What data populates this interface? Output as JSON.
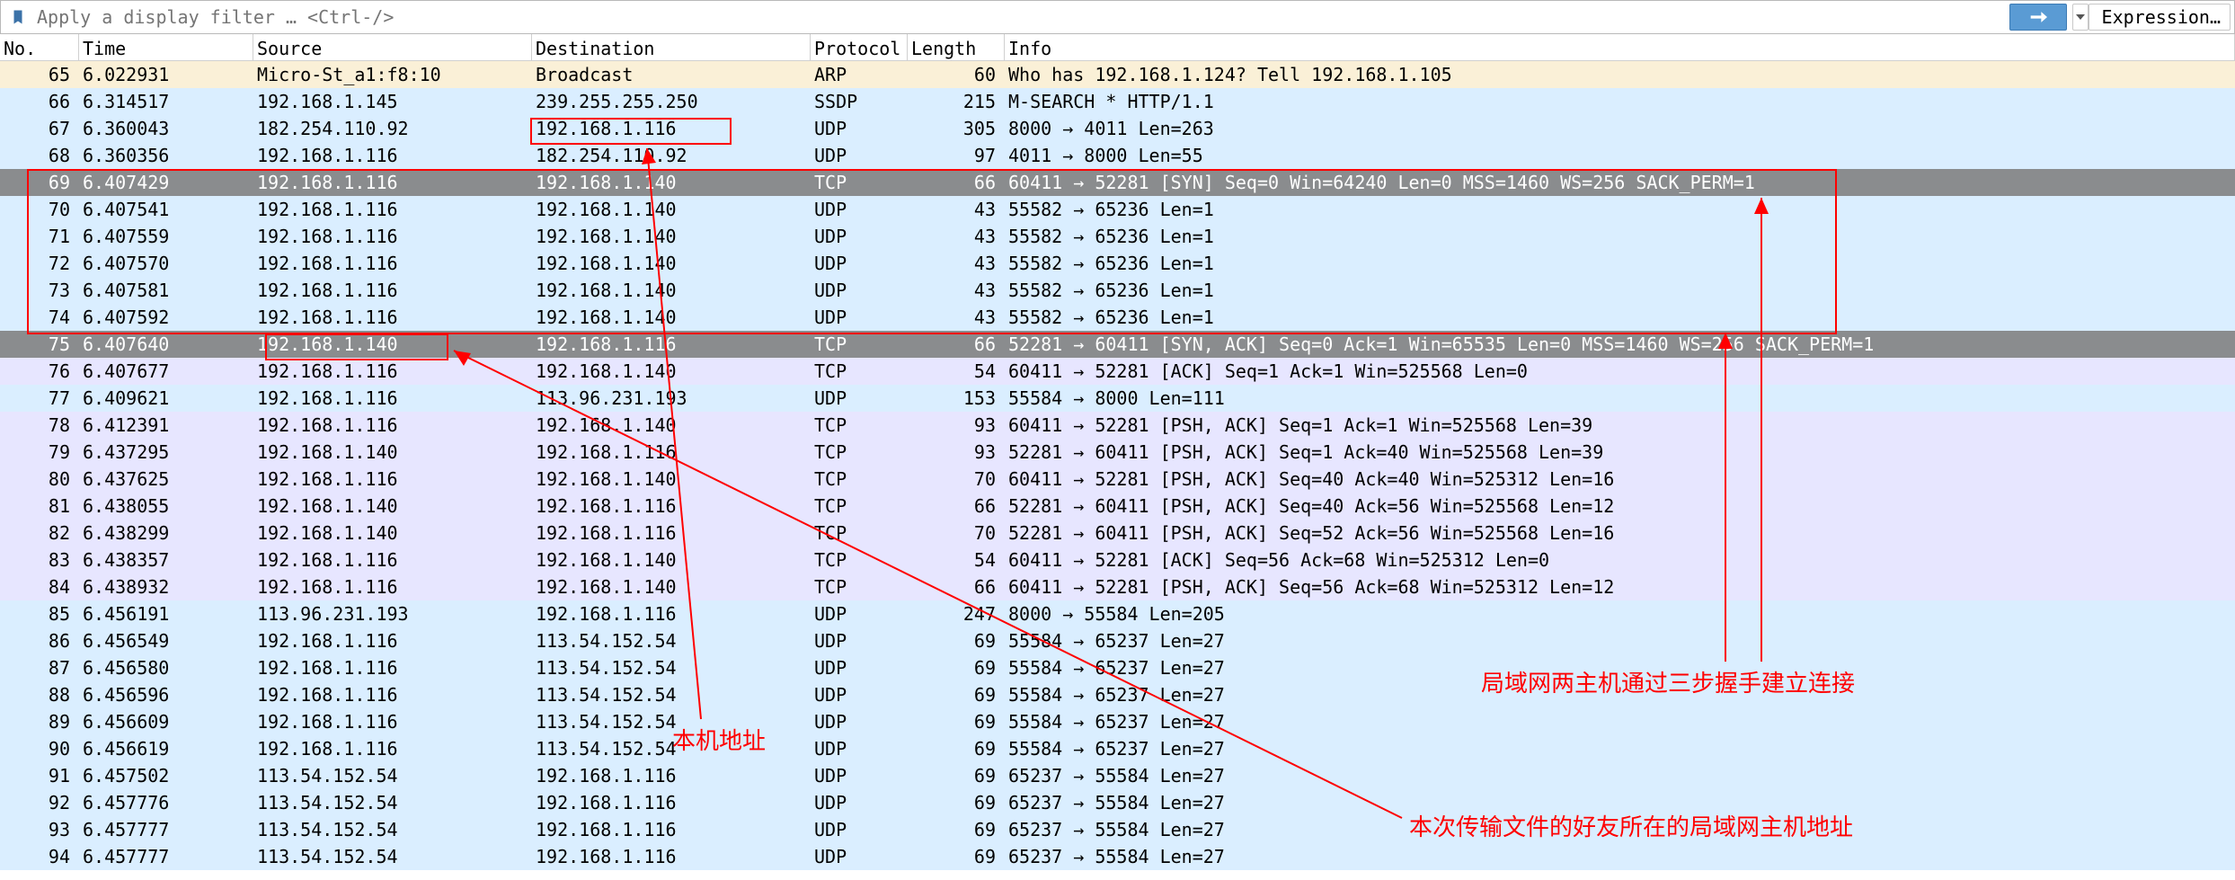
{
  "filter": {
    "placeholder": "Apply a display filter … <Ctrl-/>",
    "expression_label": "Expression…"
  },
  "columns": {
    "no": "No.",
    "time": "Time",
    "src": "Source",
    "dst": "Destination",
    "proto": "Protocol",
    "len": "Length",
    "info": "Info"
  },
  "packets": [
    {
      "no": 65,
      "time": "6.022931",
      "src": "Micro-St_a1:f8:10",
      "dst": "Broadcast",
      "proto": "ARP",
      "len": 60,
      "info": "Who has 192.168.1.124? Tell 192.168.1.105",
      "cls": "arp"
    },
    {
      "no": 66,
      "time": "6.314517",
      "src": "192.168.1.145",
      "dst": "239.255.255.250",
      "proto": "SSDP",
      "len": 215,
      "info": "M-SEARCH * HTTP/1.1",
      "cls": "udp"
    },
    {
      "no": 67,
      "time": "6.360043",
      "src": "182.254.110.92",
      "dst": "192.168.1.116",
      "proto": "UDP",
      "len": 305,
      "info": "8000 → 4011 Len=263",
      "cls": "udp"
    },
    {
      "no": 68,
      "time": "6.360356",
      "src": "192.168.1.116",
      "dst": "182.254.110.92",
      "proto": "UDP",
      "len": 97,
      "info": "4011 → 8000 Len=55",
      "cls": "udp"
    },
    {
      "no": 69,
      "time": "6.407429",
      "src": "192.168.1.116",
      "dst": "192.168.1.140",
      "proto": "TCP",
      "len": 66,
      "info": "60411 → 52281 [SYN] Seq=0 Win=64240 Len=0 MSS=1460 WS=256 SACK_PERM=1",
      "cls": "tcp-sel"
    },
    {
      "no": 70,
      "time": "6.407541",
      "src": "192.168.1.116",
      "dst": "192.168.1.140",
      "proto": "UDP",
      "len": 43,
      "info": "55582 → 65236 Len=1",
      "cls": "udp"
    },
    {
      "no": 71,
      "time": "6.407559",
      "src": "192.168.1.116",
      "dst": "192.168.1.140",
      "proto": "UDP",
      "len": 43,
      "info": "55582 → 65236 Len=1",
      "cls": "udp"
    },
    {
      "no": 72,
      "time": "6.407570",
      "src": "192.168.1.116",
      "dst": "192.168.1.140",
      "proto": "UDP",
      "len": 43,
      "info": "55582 → 65236 Len=1",
      "cls": "udp"
    },
    {
      "no": 73,
      "time": "6.407581",
      "src": "192.168.1.116",
      "dst": "192.168.1.140",
      "proto": "UDP",
      "len": 43,
      "info": "55582 → 65236 Len=1",
      "cls": "udp"
    },
    {
      "no": 74,
      "time": "6.407592",
      "src": "192.168.1.116",
      "dst": "192.168.1.140",
      "proto": "UDP",
      "len": 43,
      "info": "55582 → 65236 Len=1",
      "cls": "udp"
    },
    {
      "no": 75,
      "time": "6.407640",
      "src": "192.168.1.140",
      "dst": "192.168.1.116",
      "proto": "TCP",
      "len": 66,
      "info": "52281 → 60411 [SYN, ACK] Seq=0 Ack=1 Win=65535 Len=0 MSS=1460 WS=256 SACK_PERM=1",
      "cls": "tcp-sel"
    },
    {
      "no": 76,
      "time": "6.407677",
      "src": "192.168.1.116",
      "dst": "192.168.1.140",
      "proto": "TCP",
      "len": 54,
      "info": "60411 → 52281 [ACK] Seq=1 Ack=1 Win=525568 Len=0",
      "cls": "tcp"
    },
    {
      "no": 77,
      "time": "6.409621",
      "src": "192.168.1.116",
      "dst": "113.96.231.193",
      "proto": "UDP",
      "len": 153,
      "info": "55584 → 8000 Len=111",
      "cls": "udp"
    },
    {
      "no": 78,
      "time": "6.412391",
      "src": "192.168.1.116",
      "dst": "192.168.1.140",
      "proto": "TCP",
      "len": 93,
      "info": "60411 → 52281 [PSH, ACK] Seq=1 Ack=1 Win=525568 Len=39",
      "cls": "tcp"
    },
    {
      "no": 79,
      "time": "6.437295",
      "src": "192.168.1.140",
      "dst": "192.168.1.116",
      "proto": "TCP",
      "len": 93,
      "info": "52281 → 60411 [PSH, ACK] Seq=1 Ack=40 Win=525568 Len=39",
      "cls": "tcp"
    },
    {
      "no": 80,
      "time": "6.437625",
      "src": "192.168.1.116",
      "dst": "192.168.1.140",
      "proto": "TCP",
      "len": 70,
      "info": "60411 → 52281 [PSH, ACK] Seq=40 Ack=40 Win=525312 Len=16",
      "cls": "tcp"
    },
    {
      "no": 81,
      "time": "6.438055",
      "src": "192.168.1.140",
      "dst": "192.168.1.116",
      "proto": "TCP",
      "len": 66,
      "info": "52281 → 60411 [PSH, ACK] Seq=40 Ack=56 Win=525568 Len=12",
      "cls": "tcp"
    },
    {
      "no": 82,
      "time": "6.438299",
      "src": "192.168.1.140",
      "dst": "192.168.1.116",
      "proto": "TCP",
      "len": 70,
      "info": "52281 → 60411 [PSH, ACK] Seq=52 Ack=56 Win=525568 Len=16",
      "cls": "tcp"
    },
    {
      "no": 83,
      "time": "6.438357",
      "src": "192.168.1.116",
      "dst": "192.168.1.140",
      "proto": "TCP",
      "len": 54,
      "info": "60411 → 52281 [ACK] Seq=56 Ack=68 Win=525312 Len=0",
      "cls": "tcp"
    },
    {
      "no": 84,
      "time": "6.438932",
      "src": "192.168.1.116",
      "dst": "192.168.1.140",
      "proto": "TCP",
      "len": 66,
      "info": "60411 → 52281 [PSH, ACK] Seq=56 Ack=68 Win=525312 Len=12",
      "cls": "tcp"
    },
    {
      "no": 85,
      "time": "6.456191",
      "src": "113.96.231.193",
      "dst": "192.168.1.116",
      "proto": "UDP",
      "len": 247,
      "info": "8000 → 55584 Len=205",
      "cls": "udp"
    },
    {
      "no": 86,
      "time": "6.456549",
      "src": "192.168.1.116",
      "dst": "113.54.152.54",
      "proto": "UDP",
      "len": 69,
      "info": "55584 → 65237 Len=27",
      "cls": "udp"
    },
    {
      "no": 87,
      "time": "6.456580",
      "src": "192.168.1.116",
      "dst": "113.54.152.54",
      "proto": "UDP",
      "len": 69,
      "info": "55584 → 65237 Len=27",
      "cls": "udp"
    },
    {
      "no": 88,
      "time": "6.456596",
      "src": "192.168.1.116",
      "dst": "113.54.152.54",
      "proto": "UDP",
      "len": 69,
      "info": "55584 → 65237 Len=27",
      "cls": "udp"
    },
    {
      "no": 89,
      "time": "6.456609",
      "src": "192.168.1.116",
      "dst": "113.54.152.54",
      "proto": "UDP",
      "len": 69,
      "info": "55584 → 65237 Len=27",
      "cls": "udp"
    },
    {
      "no": 90,
      "time": "6.456619",
      "src": "192.168.1.116",
      "dst": "113.54.152.54",
      "proto": "UDP",
      "len": 69,
      "info": "55584 → 65237 Len=27",
      "cls": "udp"
    },
    {
      "no": 91,
      "time": "6.457502",
      "src": "113.54.152.54",
      "dst": "192.168.1.116",
      "proto": "UDP",
      "len": 69,
      "info": "65237 → 55584 Len=27",
      "cls": "udp"
    },
    {
      "no": 92,
      "time": "6.457776",
      "src": "113.54.152.54",
      "dst": "192.168.1.116",
      "proto": "UDP",
      "len": 69,
      "info": "65237 → 55584 Len=27",
      "cls": "udp"
    },
    {
      "no": 93,
      "time": "6.457777",
      "src": "113.54.152.54",
      "dst": "192.168.1.116",
      "proto": "UDP",
      "len": 69,
      "info": "65237 → 55584 Len=27",
      "cls": "udp"
    },
    {
      "no": 94,
      "time": "6.457777",
      "src": "113.54.152.54",
      "dst": "192.168.1.116",
      "proto": "UDP",
      "len": 69,
      "info": "65237 → 55584 Len=27",
      "cls": "udp"
    }
  ],
  "annotations": {
    "label_local_host": "本机地址",
    "label_handshake": "局域网两主机通过三步握手建立连接",
    "label_peer_host": "本次传输文件的好友所在的局域网主机地址"
  }
}
